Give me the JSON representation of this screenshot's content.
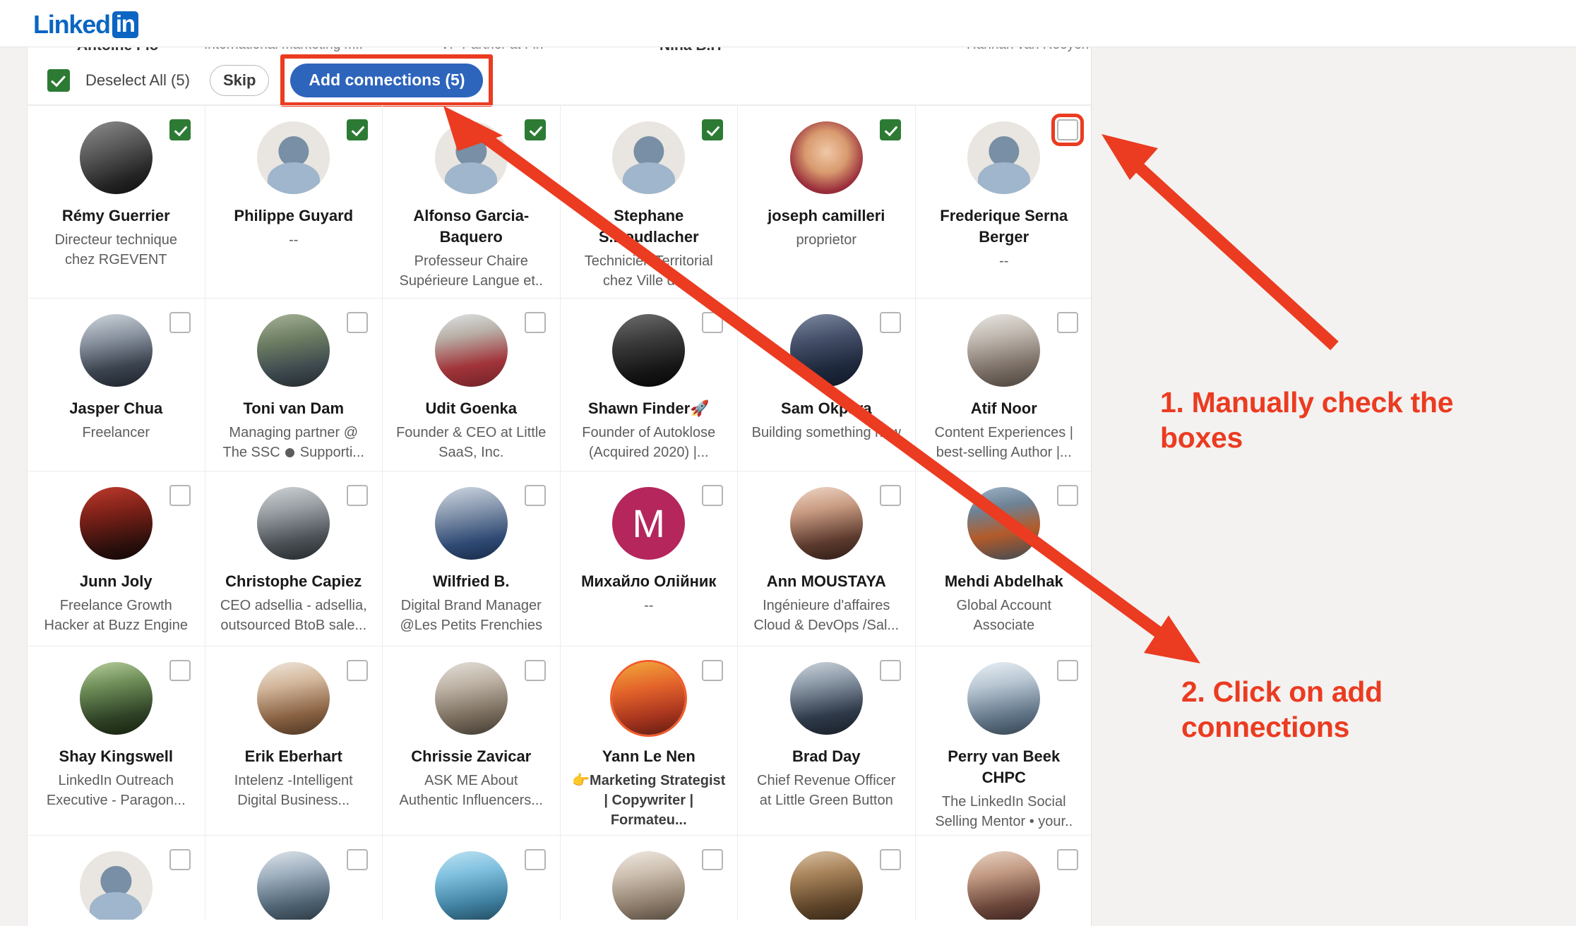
{
  "brand": {
    "logo_text": "Linked",
    "logo_badge": "in",
    "accent": "#0a66c2"
  },
  "annotation_color": "#eb3b21",
  "toolbar": {
    "deselect_label": "Deselect All (5)",
    "skip_label": "Skip",
    "add_label": "Add connections (5)",
    "select_all_checked": true
  },
  "clipped_row": [
    {
      "name": "…",
      "title": ""
    },
    {
      "name": "…",
      "title": ""
    },
    {
      "name": "…",
      "title": ""
    },
    {
      "name": "…",
      "title": ""
    },
    {
      "name": "",
      "title": ""
    },
    {
      "name": "…",
      "title": ""
    }
  ],
  "annotations": [
    {
      "id": 1,
      "text": "1. Manually check the boxes"
    },
    {
      "id": 2,
      "text": "2. Click on add connections"
    }
  ],
  "rows": [
    [
      {
        "name": "Rémy Guerrier",
        "title": "Directeur technique chez RGEVENT",
        "checked": true,
        "avatar": "photo-man-vest"
      },
      {
        "name": "Philippe Guyard",
        "title": "--",
        "checked": true,
        "avatar": "placeholder"
      },
      {
        "name": "Alfonso Garcia-Baquero",
        "title": "Professeur Chaire Supérieure Langue et..",
        "checked": true,
        "avatar": "placeholder"
      },
      {
        "name": "Stephane S.Boudlacher",
        "title": "Technicien Territorial chez Ville de...",
        "checked": true,
        "avatar": "placeholder"
      },
      {
        "name": "joseph camilleri",
        "title": "proprietor",
        "checked": true,
        "avatar": "photo-child"
      },
      {
        "name": "Frederique Serna Berger",
        "title": "--",
        "checked": false,
        "avatar": "placeholder",
        "highlight": true
      }
    ],
    [
      {
        "name": "Jasper Chua",
        "title": "Freelancer",
        "checked": false,
        "avatar": "photo-man-asian"
      },
      {
        "name": "Toni van Dam",
        "title": "Managing partner @ The SSC ● Supporti...",
        "checked": false,
        "avatar": "photo-man-blond"
      },
      {
        "name": "Udit Goenka",
        "title": "Founder & CEO at Little SaaS, Inc.",
        "checked": false,
        "avatar": "photo-man-red"
      },
      {
        "name": "Shawn Finder🚀",
        "title": "Founder of Autoklose (Acquired 2020) |...",
        "checked": false,
        "avatar": "photo-man-dark"
      },
      {
        "name": "Sam Okpara",
        "title": "Building something new",
        "checked": false,
        "avatar": "photo-man-suit"
      },
      {
        "name": "Atif Noor",
        "title": "Content Experiences | best-selling Author |...",
        "checked": false,
        "avatar": "photo-man-glasses"
      }
    ],
    [
      {
        "name": "Junn Joly",
        "title": "Freelance Growth Hacker at Buzz Engine",
        "checked": false,
        "avatar": "photo-man-red2"
      },
      {
        "name": "Christophe Capiez",
        "title": "CEO adsellia - adsellia, outsourced BtoB sale...",
        "checked": false,
        "avatar": "photo-man-suit2"
      },
      {
        "name": "Wilfried B.",
        "title": "Digital Brand Manager @Les Petits Frenchies",
        "checked": false,
        "avatar": "photo-man-blue"
      },
      {
        "name": "Михайло Олійник",
        "title": "--",
        "checked": false,
        "avatar": "letter-M"
      },
      {
        "name": "Ann MOUSTAYA",
        "title": "Ingénieure d'affaires Cloud & DevOps /Sal...",
        "checked": false,
        "avatar": "photo-woman"
      },
      {
        "name": "Mehdi Abdelhak",
        "title": "Global Account Associate",
        "checked": false,
        "avatar": "photo-man-cap"
      }
    ],
    [
      {
        "name": "Shay Kingswell",
        "title": "LinkedIn Outreach Executive - Paragon...",
        "checked": false,
        "avatar": "photo-man-green"
      },
      {
        "name": "Erik Eberhart",
        "title": "Intelenz -Intelligent Digital Business...",
        "checked": false,
        "avatar": "photo-man-bald"
      },
      {
        "name": "Chrissie Zavicar",
        "title": "ASK ME About Authentic Influencers...",
        "checked": false,
        "avatar": "photo-woman2"
      },
      {
        "name": "Yann Le Nen",
        "title": "👉Marketing Strategist | Copywriter | Formateu...",
        "checked": false,
        "avatar": "photo-man-ring",
        "title_bold": true
      },
      {
        "name": "Brad Day",
        "title": "Chief Revenue Officer at Little Green Button",
        "checked": false,
        "avatar": "photo-man-suit3"
      },
      {
        "name": "Perry van Beek CHPC",
        "title": "The LinkedIn Social Selling Mentor • your..",
        "checked": false,
        "avatar": "photo-man-white"
      }
    ],
    [
      {
        "name": "",
        "title": "",
        "checked": false,
        "avatar": "placeholder"
      },
      {
        "name": "",
        "title": "",
        "checked": false,
        "avatar": "photo-man-office"
      },
      {
        "name": "",
        "title": "",
        "checked": false,
        "avatar": "photo-woman3"
      },
      {
        "name": "",
        "title": "",
        "checked": false,
        "avatar": "photo-man-older"
      },
      {
        "name": "",
        "title": "",
        "checked": false,
        "avatar": "photo-man-brown"
      },
      {
        "name": "",
        "title": "",
        "checked": false,
        "avatar": "photo-woman4"
      }
    ]
  ]
}
